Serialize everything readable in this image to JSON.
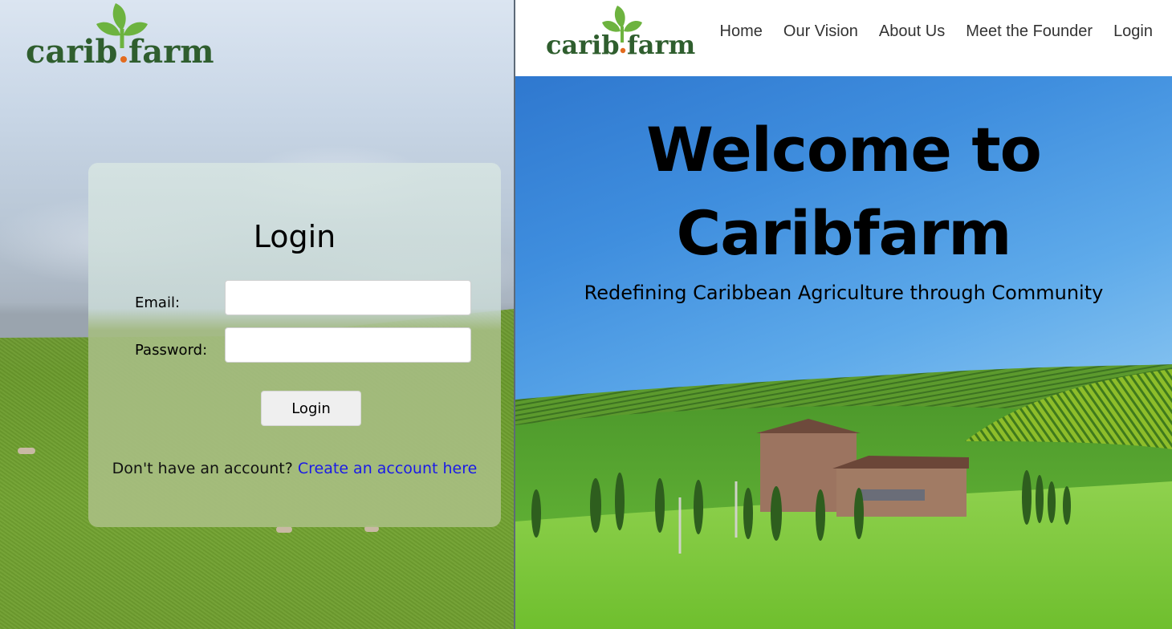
{
  "left_window": {
    "brand": {
      "name_left": "carib",
      "name_right": "farm",
      "logo_colors": {
        "text": "#2f5e2e",
        "leaf": "#6db33f",
        "seed": "#e36b1e"
      }
    },
    "login_form": {
      "title": "Login",
      "email_label": "Email:",
      "email_value": "",
      "password_label": "Password:",
      "password_value": "",
      "submit_label": "Login",
      "signup_prompt": "Don't have an account?",
      "signup_link": "Create an account here",
      "link_color": "#1a1ae6"
    }
  },
  "right_window": {
    "brand": {
      "name_left": "carib",
      "name_right": "farm"
    },
    "nav": {
      "items": [
        {
          "label": "Home"
        },
        {
          "label": "Our Vision"
        },
        {
          "label": "About Us"
        },
        {
          "label": "Meet the Founder"
        },
        {
          "label": "Login"
        }
      ]
    },
    "hero": {
      "title_line1": "Welcome to",
      "title_line2": "Caribfarm",
      "subtitle": "Redefining Caribbean Agriculture through Community"
    }
  }
}
